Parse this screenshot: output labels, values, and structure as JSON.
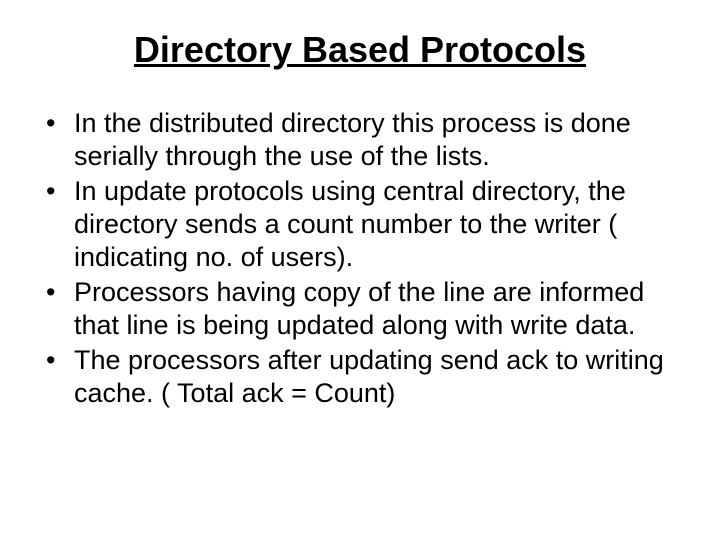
{
  "title": "Directory Based Protocols",
  "bullets": [
    "In the distributed directory this process is done serially through the use of the lists.",
    "In update protocols using central directory, the directory sends a count number to the writer ( indicating no. of users).",
    "Processors having copy of the line are informed that line is being updated along with write data.",
    "The processors after updating send ack to writing cache. ( Total ack = Count)"
  ]
}
